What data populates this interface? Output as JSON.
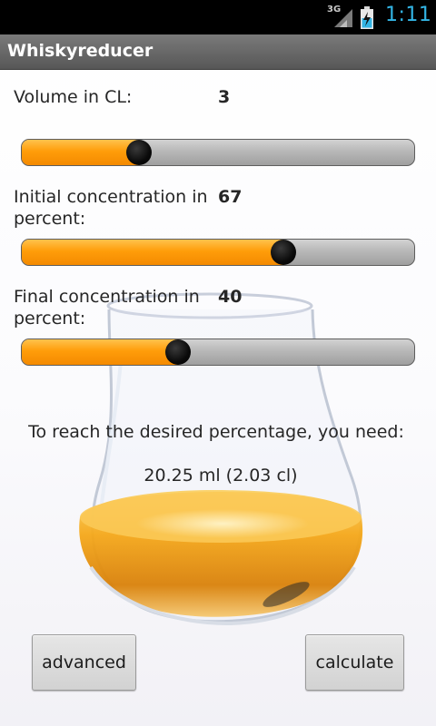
{
  "status_bar": {
    "network": "3G",
    "time": "1:11"
  },
  "app": {
    "title": "Whiskyreducer"
  },
  "controls": {
    "volume": {
      "label": "Volume in CL:",
      "value": "3",
      "slider_fraction": 0.3
    },
    "initial_concentration": {
      "label_line1": "Initial concentration in",
      "label_line2": "percent:",
      "value": "67",
      "slider_fraction": 0.67
    },
    "final_concentration": {
      "label_line1": "Final concentration in",
      "label_line2": "percent:",
      "value": "40",
      "slider_fraction": 0.4
    }
  },
  "result": {
    "heading": "To reach the desired percentage, you need:",
    "value": "20.25 ml (2.03 cl)"
  },
  "buttons": {
    "advanced_label": "advanced",
    "calculate_label": "calculate"
  },
  "colors": {
    "accent": "#ff9d0a",
    "clock": "#33b5e5"
  }
}
